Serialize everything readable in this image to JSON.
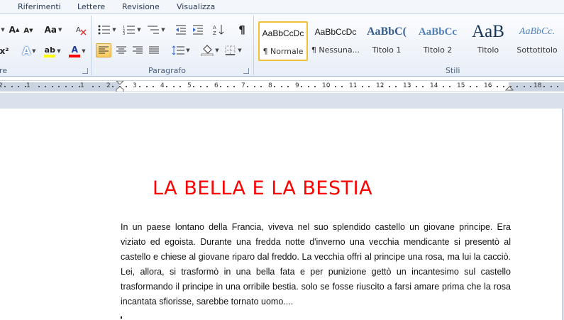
{
  "tabs": [
    "Riferimenti",
    "Lettere",
    "Revisione",
    "Visualizza"
  ],
  "ribbon": {
    "font_group_label": "re",
    "paragraph_group_label": "Paragrafo",
    "styles_group_label": "Stili",
    "font_buttons": {
      "grow": "A",
      "shrink": "A",
      "change_case": "Aa",
      "superscript": "x²",
      "text_effects": "A",
      "highlight": "ab",
      "font_color": "A"
    },
    "paragraph_symbols": {
      "show_marks": "¶",
      "sort": "A↓Z"
    }
  },
  "styles": [
    {
      "sample": "AaBbCcDc",
      "name": "¶ Normale",
      "selected": true
    },
    {
      "sample": "AaBbCcDc",
      "name": "¶ Nessuna...",
      "selected": false
    },
    {
      "sample": "AaBbC(",
      "name": "Titolo 1",
      "selected": false
    },
    {
      "sample": "AaBbCc",
      "name": "Titolo 2",
      "selected": false
    },
    {
      "sample": "AaB",
      "name": "Titolo",
      "selected": false
    },
    {
      "sample": "AaBbCc.",
      "name": "Sottotitolo",
      "selected": false
    }
  ],
  "ruler": {
    "labels": [
      "2",
      "1",
      "1",
      "2",
      "3",
      "4",
      "5",
      "6",
      "7",
      "8",
      "9",
      "10",
      "11",
      "12",
      "13",
      "14",
      "15",
      "16",
      "18"
    ]
  },
  "document": {
    "title": "LA BELLA E LA BESTIA",
    "body": "In un paese lontano della Francia, viveva nel suo splendido castello un giovane principe. Era viziato ed egoista. Durante una fredda notte d'inverno una vecchia mendicante si presentò al castello e chiese al giovane riparo dal freddo. La vecchia offrì al principe una rosa, ma lui la cacciò. Lei, allora, si trasformò in una bella fata e per punizione gettò un incantesimo sul castello trasformando il principe in una orribile bestia. solo se fosse riuscito a farsi amare prima che la rosa incantata sfiorisse, sarebbe tornato uomo....",
    "title_color": "#ff0000"
  },
  "colors": {
    "ribbon_accent": "#f0c03a",
    "highlight_yellow": "#ffff00",
    "font_color_red": "#ff0000"
  }
}
